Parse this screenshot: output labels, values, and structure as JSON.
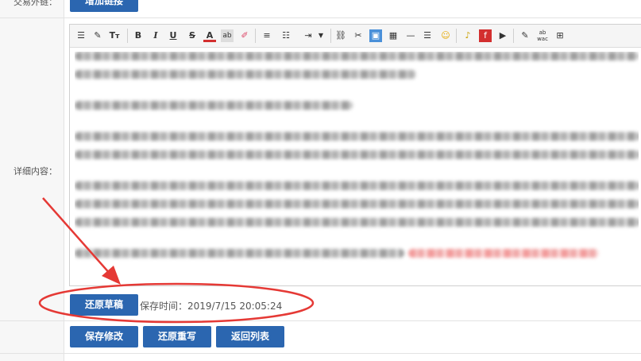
{
  "form": {
    "external_link": {
      "label": "交易外链：",
      "button": "增加链接"
    },
    "detail": {
      "label": "详细内容：",
      "toolbar": {
        "items": [
          "source-code-icon",
          "format-painter-icon",
          "font-size-icon",
          "bold-icon",
          "italic-icon",
          "underline-icon",
          "strikethrough-icon",
          "font-color-icon",
          "background-color-icon",
          "eraser-icon",
          "align-icon",
          "unordered-list-icon",
          "indent-icon",
          "link-icon",
          "unlink-icon",
          "image-icon",
          "table-icon",
          "horizontal-rule-icon",
          "page-break-icon",
          "emoticon-icon",
          "music-icon",
          "flash-icon",
          "video-icon",
          "clear-format-icon",
          "spellcheck-icon",
          "select-all-icon"
        ],
        "bold": "B",
        "italic": "I",
        "underline": "U",
        "strike": "S",
        "font_color": "A"
      },
      "restore_draft": "还原草稿",
      "save_time": "保存时间：2019/7/15 20:05:24"
    },
    "actions": {
      "save": "保存修改",
      "reset": "还原重写",
      "back": "返回列表"
    }
  },
  "colors": {
    "primary": "#2b66b0",
    "annotation": "#e53935"
  }
}
